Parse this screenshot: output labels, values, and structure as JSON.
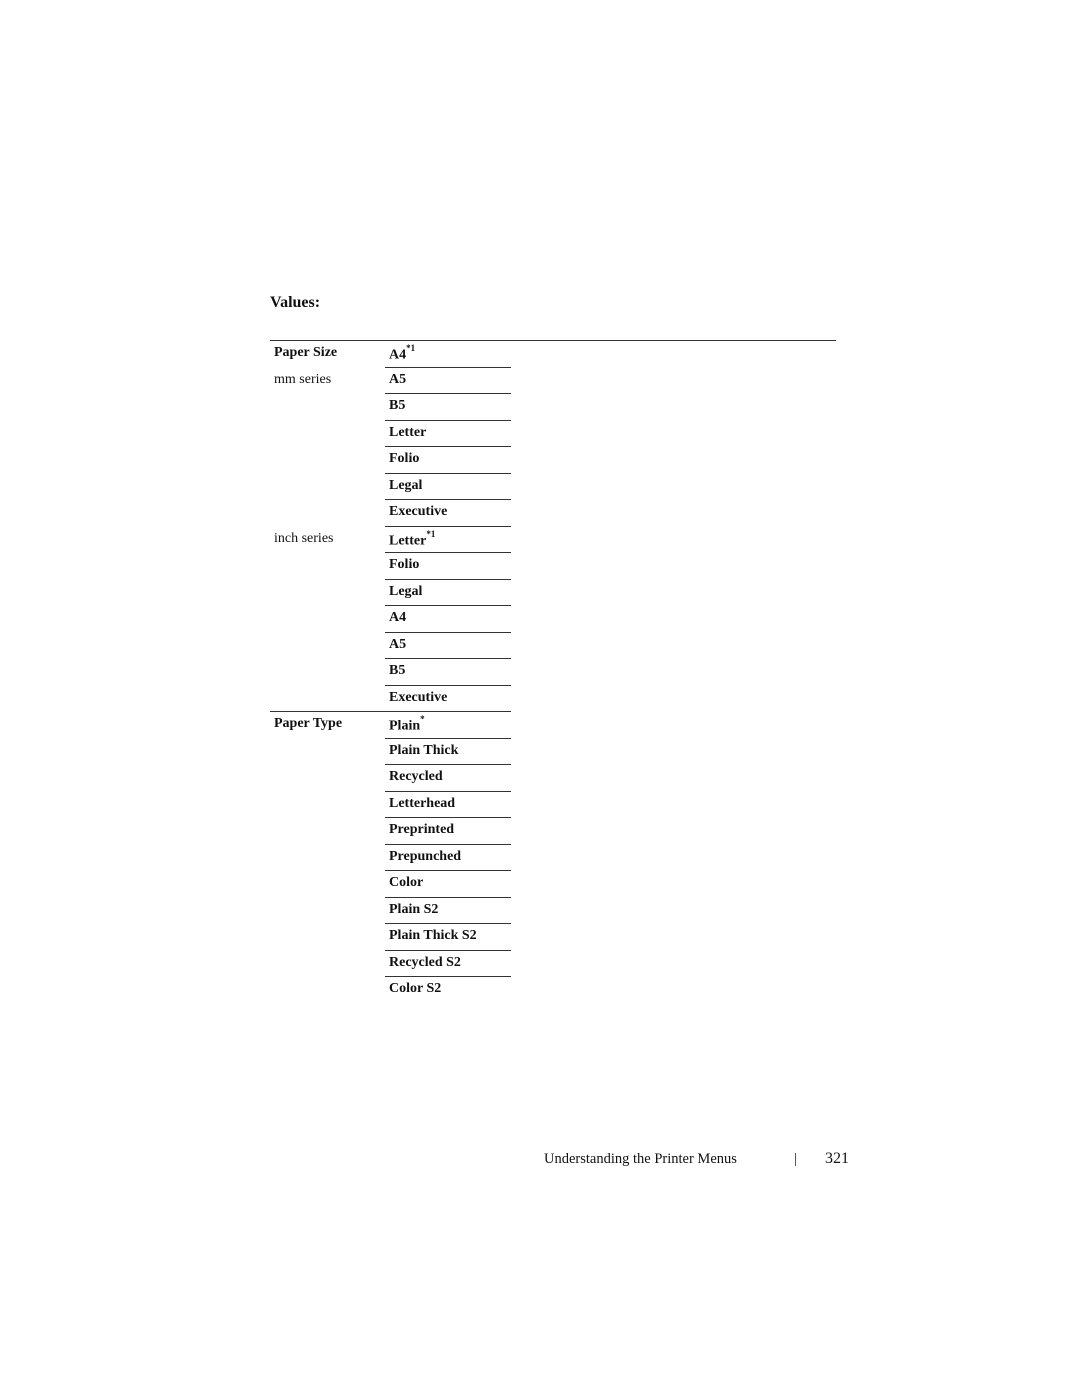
{
  "heading": "Values:",
  "sections": [
    {
      "label": "Paper Size",
      "rows": [
        {
          "sublabel": "Paper Size",
          "bold": true,
          "value": "A4",
          "mark": "*1"
        },
        {
          "sublabel": "mm series",
          "bold": false,
          "value": "A5",
          "mark": ""
        },
        {
          "sublabel": "",
          "bold": false,
          "value": "B5",
          "mark": ""
        },
        {
          "sublabel": "",
          "bold": false,
          "value": "Letter",
          "mark": ""
        },
        {
          "sublabel": "",
          "bold": false,
          "value": "Folio",
          "mark": ""
        },
        {
          "sublabel": "",
          "bold": false,
          "value": "Legal",
          "mark": ""
        },
        {
          "sublabel": "",
          "bold": false,
          "value": "Executive",
          "mark": ""
        },
        {
          "sublabel": "inch series",
          "bold": false,
          "value": "Letter",
          "mark": "*1"
        },
        {
          "sublabel": "",
          "bold": false,
          "value": "Folio",
          "mark": ""
        },
        {
          "sublabel": "",
          "bold": false,
          "value": "Legal",
          "mark": ""
        },
        {
          "sublabel": "",
          "bold": false,
          "value": "A4",
          "mark": ""
        },
        {
          "sublabel": "",
          "bold": false,
          "value": "A5",
          "mark": ""
        },
        {
          "sublabel": "",
          "bold": false,
          "value": "B5",
          "mark": ""
        },
        {
          "sublabel": "",
          "bold": false,
          "value": "Executive",
          "mark": ""
        }
      ]
    },
    {
      "label": "Paper Type",
      "rows": [
        {
          "sublabel": "Paper Type",
          "bold": true,
          "value": "Plain",
          "mark": "*"
        },
        {
          "sublabel": "",
          "bold": false,
          "value": "Plain Thick",
          "mark": ""
        },
        {
          "sublabel": "",
          "bold": false,
          "value": "Recycled",
          "mark": ""
        },
        {
          "sublabel": "",
          "bold": false,
          "value": "Letterhead",
          "mark": ""
        },
        {
          "sublabel": "",
          "bold": false,
          "value": "Preprinted",
          "mark": ""
        },
        {
          "sublabel": "",
          "bold": false,
          "value": "Prepunched",
          "mark": ""
        },
        {
          "sublabel": "",
          "bold": false,
          "value": "Color",
          "mark": ""
        },
        {
          "sublabel": "",
          "bold": false,
          "value": "Plain S2",
          "mark": ""
        },
        {
          "sublabel": "",
          "bold": false,
          "value": "Plain Thick S2",
          "mark": ""
        },
        {
          "sublabel": "",
          "bold": false,
          "value": "Recycled S2",
          "mark": ""
        },
        {
          "sublabel": "",
          "bold": false,
          "value": "Color S2",
          "mark": ""
        }
      ]
    }
  ],
  "footer": {
    "title": "Understanding the Printer Menus",
    "separator": "|",
    "page": "321"
  }
}
